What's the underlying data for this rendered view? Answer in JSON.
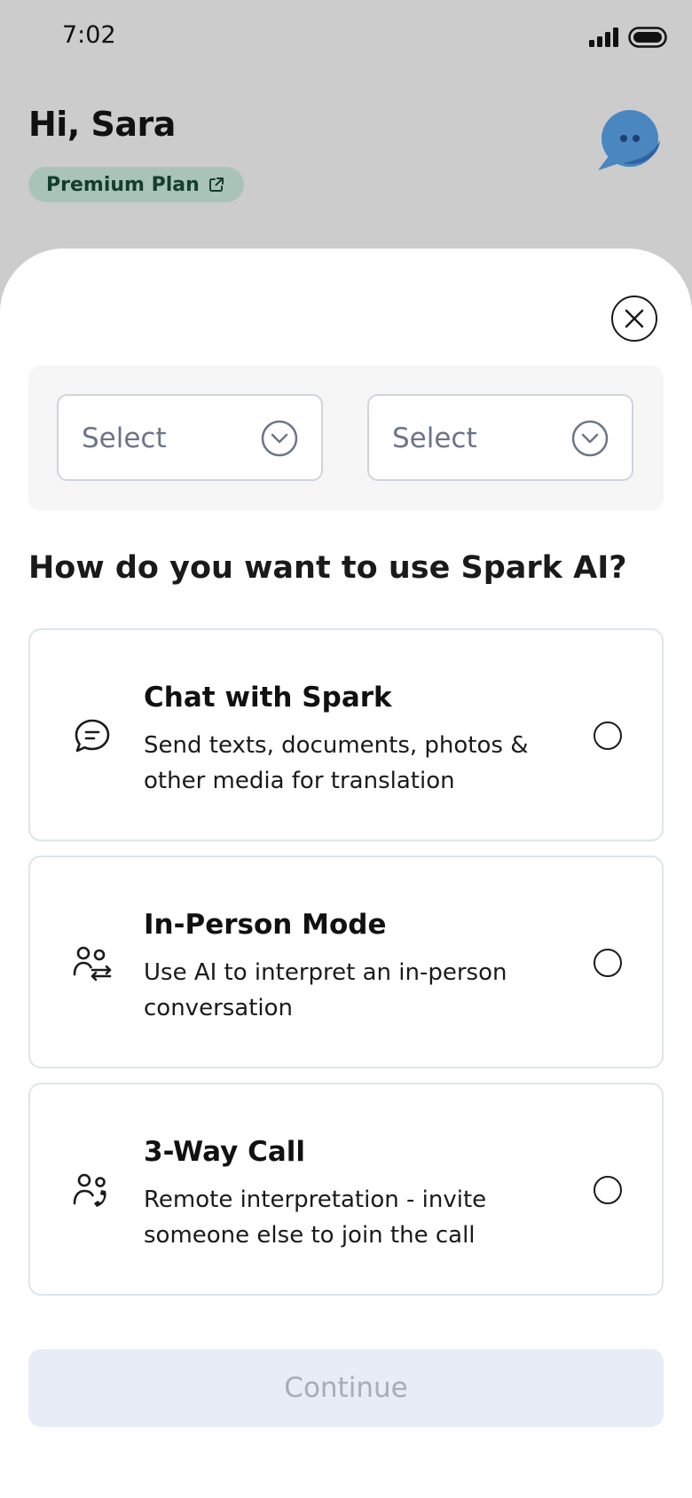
{
  "status_bar": {
    "time": "7:02"
  },
  "header": {
    "greeting": "Hi, Sara",
    "plan_badge": "Premium Plan"
  },
  "selectors": [
    {
      "label": "Select"
    },
    {
      "label": "Select"
    }
  ],
  "question": "How do you want to use Spark AI?",
  "options": [
    {
      "title": "Chat with Spark",
      "description": "Send texts, documents, photos & other media for translation",
      "icon": "chat-icon",
      "selected": false
    },
    {
      "title": "In-Person Mode",
      "description": "Use AI to interpret an in-person conversation",
      "icon": "in-person-icon",
      "selected": false
    },
    {
      "title": "3-Way Call",
      "description": "Remote interpretation - invite someone else to join the call",
      "icon": "call-icon",
      "selected": false
    }
  ],
  "continue_label": "Continue",
  "colors": {
    "backdrop": "#cccccc",
    "badge_bg": "#a9c3b8",
    "badge_text": "#143d2c",
    "bubble_blue": "#4a86c0",
    "card_border": "#dbe5f0",
    "button_disabled_bg": "#e8ecf6",
    "button_disabled_text": "#a6acb8"
  }
}
